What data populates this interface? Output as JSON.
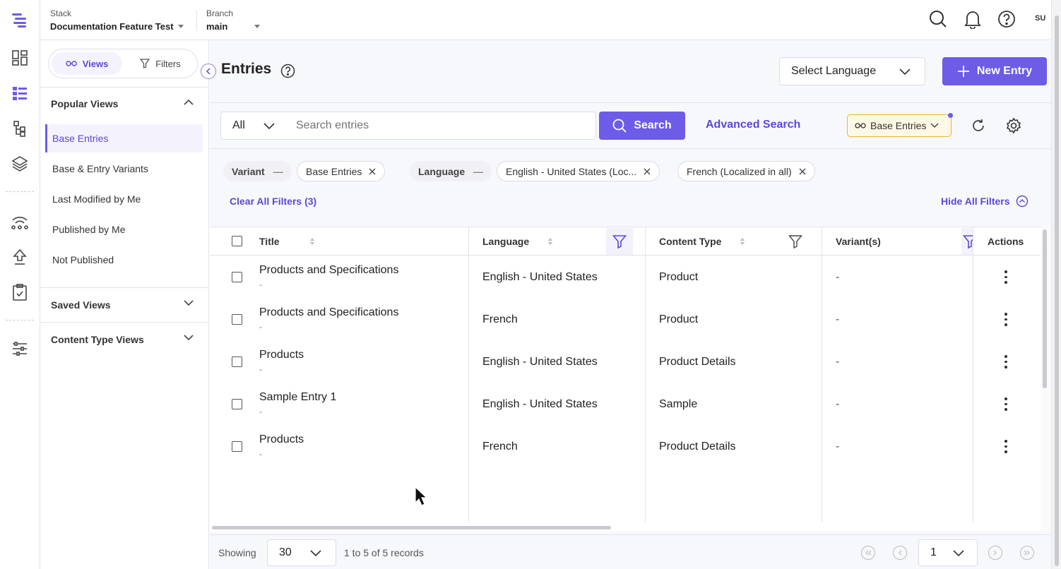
{
  "header": {
    "stack_label": "Stack",
    "stack_value": "Documentation Feature Test",
    "branch_label": "Branch",
    "branch_value": "main",
    "user_initials": "SU"
  },
  "sidebar": {
    "views_tab": "Views",
    "filters_tab": "Filters",
    "popular_views_title": "Popular Views",
    "popular_views": [
      "Base Entries",
      "Base & Entry Variants",
      "Last Modified by Me",
      "Published by Me",
      "Not Published"
    ],
    "saved_views_title": "Saved Views",
    "content_type_views_title": "Content Type Views"
  },
  "main": {
    "title": "Entries",
    "select_language": "Select Language",
    "new_entry": "New Entry",
    "search_scope": "All",
    "search_placeholder": "Search entries",
    "search_button": "Search",
    "advanced_search": "Advanced Search",
    "view_badge": "Base Entries",
    "filters": {
      "variant_label": "Variant",
      "variant_value": "Base Entries",
      "language_label": "Language",
      "language_values": [
        "English - United States (Loc...",
        "French (Localized in all)"
      ],
      "clear_all": "Clear All Filters (3)",
      "hide_all": "Hide All Filters"
    }
  },
  "table": {
    "columns": [
      "Title",
      "Language",
      "Content Type",
      "Variant(s)",
      "Actions"
    ],
    "rows": [
      {
        "title": "Products and Specifications",
        "sub": "-",
        "language": "English - United States",
        "content_type": "Product",
        "variants": "-"
      },
      {
        "title": "Products and Specifications",
        "sub": "-",
        "language": "French",
        "content_type": "Product",
        "variants": "-"
      },
      {
        "title": "Products",
        "sub": "-",
        "language": "English - United States",
        "content_type": "Product Details",
        "variants": "-"
      },
      {
        "title": "Sample Entry 1",
        "sub": "-",
        "language": "English - United States",
        "content_type": "Sample",
        "variants": "-"
      },
      {
        "title": "Products",
        "sub": "-",
        "language": "French",
        "content_type": "Product Details",
        "variants": "-"
      }
    ]
  },
  "footer": {
    "showing_label": "Showing",
    "page_size": "30",
    "records": "1 to 5 of 5 records",
    "page": "1"
  },
  "colors": {
    "accent": "#6c5ce7",
    "badge_border": "#f0b429",
    "badge_bg": "#fff8e6"
  }
}
